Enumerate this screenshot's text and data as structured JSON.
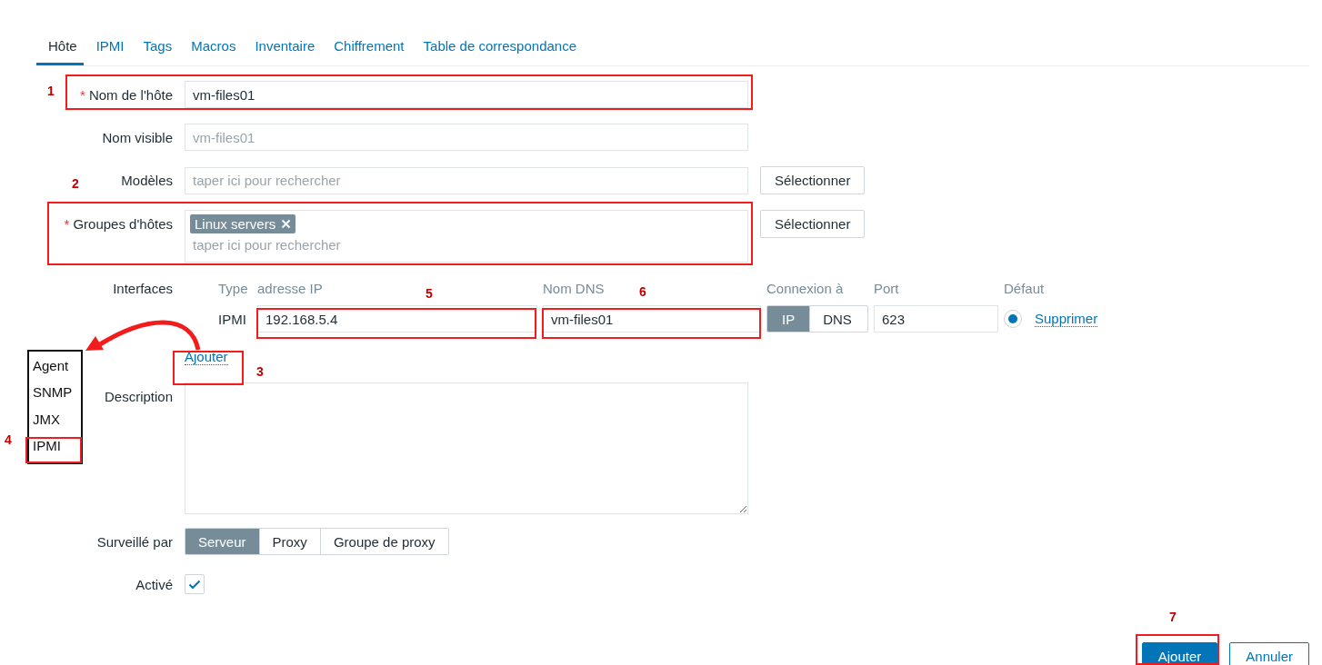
{
  "tabs": [
    {
      "label": "Hôte",
      "selected": true
    },
    {
      "label": "IPMI",
      "selected": false
    },
    {
      "label": "Tags",
      "selected": false
    },
    {
      "label": "Macros",
      "selected": false
    },
    {
      "label": "Inventaire",
      "selected": false
    },
    {
      "label": "Chiffrement",
      "selected": false
    },
    {
      "label": "Table de correspondance",
      "selected": false
    }
  ],
  "host_name": {
    "label": "Nom de l'hôte",
    "required": true,
    "value": "vm-files01"
  },
  "visible_name": {
    "label": "Nom visible",
    "required": false,
    "placeholder": "vm-files01"
  },
  "templates": {
    "label": "Modèles",
    "required": false,
    "placeholder": "taper ici pour rechercher",
    "button": "Sélectionner"
  },
  "host_groups": {
    "label": "Groupes d'hôtes",
    "required": true,
    "tags": [
      {
        "label": "Linux servers"
      }
    ],
    "placeholder": "taper ici pour rechercher",
    "button": "Sélectionner"
  },
  "interfaces": {
    "label": "Interfaces",
    "columns": [
      "Type",
      "adresse IP",
      "Nom DNS",
      "Connexion à",
      "Port",
      "Défaut"
    ],
    "rows": [
      {
        "type": "IPMI",
        "ip": "192.168.5.4",
        "dns": "vm-files01",
        "connect": [
          {
            "label": "IP",
            "selected": true
          },
          {
            "label": "DNS",
            "selected": false
          }
        ],
        "port": "623",
        "default": true,
        "remove": "Supprimer"
      }
    ],
    "add_link": "Ajouter"
  },
  "type_menu": {
    "items": [
      "Agent",
      "SNMP",
      "JMX",
      "IPMI"
    ]
  },
  "description": {
    "label": "Description"
  },
  "required_mark": "*",
  "monitored_by": {
    "label": "Surveillé par",
    "options": [
      {
        "label": "Serveur",
        "selected": true
      },
      {
        "label": "Proxy",
        "selected": false
      },
      {
        "label": "Groupe de proxy",
        "selected": false
      }
    ]
  },
  "enabled": {
    "label": "Activé",
    "checked": true
  },
  "buttons": [
    {
      "label": "Ajouter",
      "kind": "primary"
    },
    {
      "label": "Annuler",
      "kind": "secondary"
    }
  ],
  "annotations": [
    "1",
    "2",
    "3",
    "4",
    "5",
    "6",
    "7"
  ]
}
